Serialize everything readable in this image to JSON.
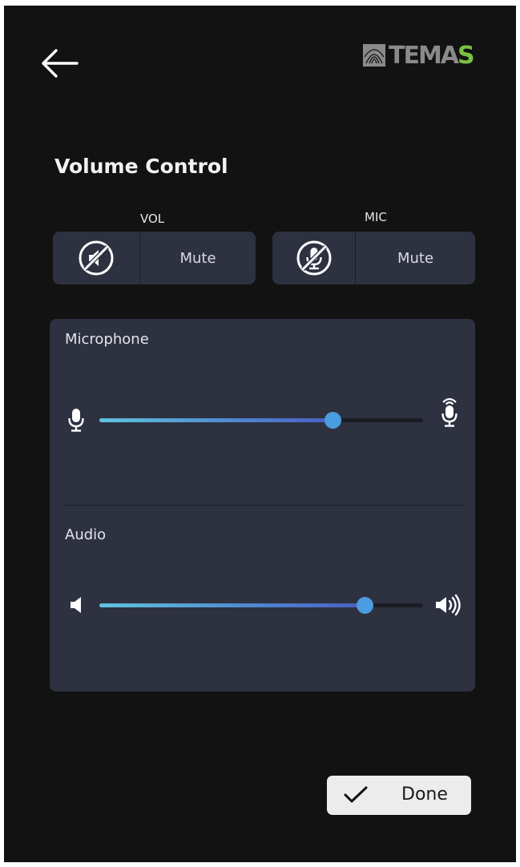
{
  "header": {
    "logo": {
      "text_main": "TEMA",
      "text_accent": "S",
      "accent_color": "#7bc043"
    }
  },
  "title": "Volume Control",
  "mute_controls": [
    {
      "group_label": "VOL",
      "label": "Mute",
      "icon": "speaker-muted-icon"
    },
    {
      "group_label": "MIC",
      "label": "Mute",
      "icon": "mic-muted-icon"
    }
  ],
  "panel": {
    "microphone": {
      "label": "Microphone",
      "level_fraction": 0.72,
      "icon_min": "mic-icon",
      "icon_max": "mic-high-icon"
    },
    "audio": {
      "label": "Audio",
      "level_fraction": 0.82,
      "icon_min": "speaker-low-icon",
      "icon_max": "speaker-high-icon"
    }
  },
  "done_button": {
    "label": "Done",
    "icon": "check-icon"
  },
  "colors": {
    "background": "#121212",
    "card": "#2d3140",
    "slider_thumb": "#4a9de0",
    "done_bg": "#ececec"
  }
}
